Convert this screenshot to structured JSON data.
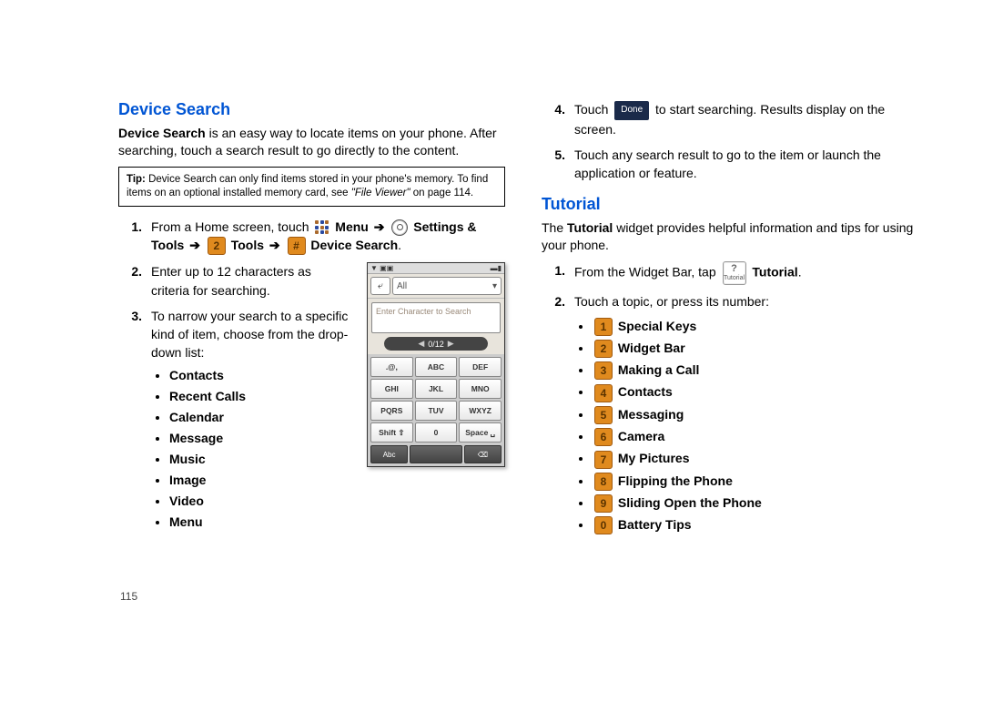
{
  "page_number": "115",
  "left": {
    "heading": "Device Search",
    "intro_bold": "Device Search",
    "intro_rest": " is an easy way to locate items on your phone. After searching, touch a search result to go directly to the content.",
    "tip_label": "Tip:",
    "tip_text": " Device Search can only find items stored in your phone's memory. To find items on an optional installed memory card, see ",
    "tip_ref": "\"File Viewer\"",
    "tip_tail": " on page 114.",
    "step1_num": "1.",
    "step1_a": "From a Home screen, touch ",
    "step1_menu": "Menu",
    "step1_settings": "Settings & Tools",
    "step1_tools": "Tools",
    "step1_devsearch": "Device Search",
    "key2": "2",
    "keyhash": "#",
    "step2_num": "2.",
    "step2": "Enter up to 12 characters as criteria for searching.",
    "step3_num": "3.",
    "step3": "To narrow your search to a specific kind of item, choose from the drop-down list:",
    "bullets": [
      "Contacts",
      "Recent Calls",
      "Calendar",
      "Message",
      "Music",
      "Image",
      "Video",
      "Menu"
    ],
    "phone": {
      "status_l": "▼ ▣▣",
      "status_r": "▬▮",
      "all": "All",
      "input": "Enter Character to Search",
      "count": "0/12",
      "keys": [
        ".@,",
        "ABC",
        "DEF",
        "GHI",
        "JKL",
        "MNO",
        "PQRS",
        "TUV",
        "WXYZ",
        "Shift ⇧",
        "0",
        "Space ␣"
      ],
      "bot": [
        "Abc",
        "",
        "⌫"
      ]
    }
  },
  "right": {
    "step4_num": "4.",
    "step4_a": "Touch ",
    "step4_done": "Done",
    "step4_b": " to start searching. Results display on the screen.",
    "step5_num": "5.",
    "step5": "Touch any search result to go to the item or launch the application or feature.",
    "heading": "Tutorial",
    "intro_a": "The ",
    "intro_bold": "Tutorial",
    "intro_b": " widget provides helpful information and tips for using your phone.",
    "step1_num": "1.",
    "step1_a": "From the Widget Bar, tap ",
    "step1_tut": "Tutorial",
    "tut_q": "?",
    "tut_lbl": "Tutorial",
    "step2_num": "2.",
    "step2": "Touch a topic, or press its number:",
    "topics": [
      {
        "n": "1",
        "t": "Special Keys"
      },
      {
        "n": "2",
        "t": "Widget Bar"
      },
      {
        "n": "3",
        "t": "Making a Call"
      },
      {
        "n": "4",
        "t": "Contacts"
      },
      {
        "n": "5",
        "t": "Messaging"
      },
      {
        "n": "6",
        "t": "Camera"
      },
      {
        "n": "7",
        "t": "My Pictures"
      },
      {
        "n": "8",
        "t": "Flipping the Phone"
      },
      {
        "n": "9",
        "t": "Sliding Open the Phone"
      },
      {
        "n": "0",
        "t": "Battery Tips"
      }
    ]
  }
}
